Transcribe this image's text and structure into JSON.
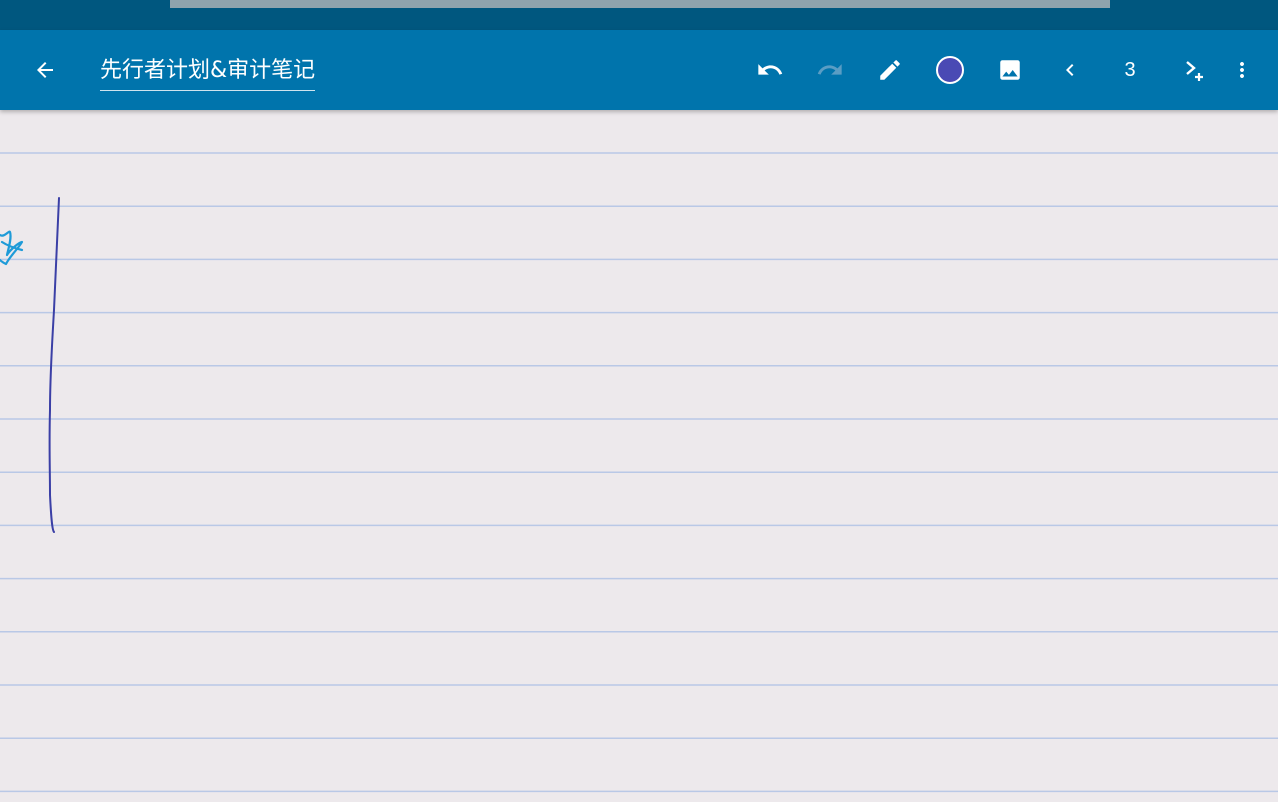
{
  "toolbar": {
    "title": "先行者计划&审计笔记",
    "page_number": "3",
    "pen_color": "#4a4ab4",
    "accent_color": "#0074ac",
    "status_bar_color": "#00577f"
  },
  "icons": {
    "back": "arrow-left-icon",
    "undo": "undo-icon",
    "redo": "redo-icon",
    "pen": "pencil-icon",
    "color": "color-picker-icon",
    "image": "image-icon",
    "prev": "chevron-left-icon",
    "next_add": "next-add-page-icon",
    "menu": "more-vert-icon"
  },
  "canvas": {
    "paper_color": "#ede9ec",
    "rule_color": "#b9c8e6",
    "ink_color": "#3b3fa6",
    "star_color": "#1f9bd8"
  }
}
